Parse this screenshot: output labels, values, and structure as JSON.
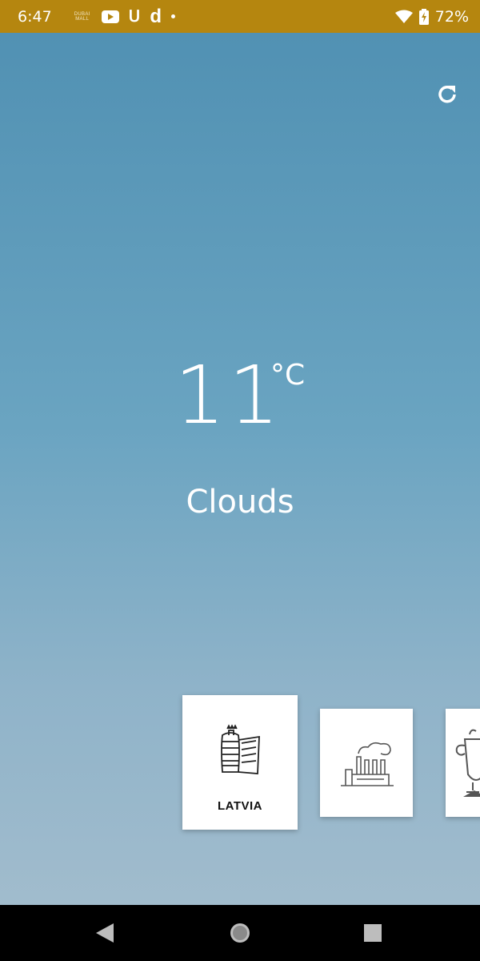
{
  "status_bar": {
    "time": "6:47",
    "mall_logo_text": "DUBAI MALL",
    "icons": [
      "mall-logo-icon",
      "youtube-icon",
      "smile-icon",
      "d-icon",
      "dot-icon",
      "wifi-icon",
      "battery-charging-icon"
    ],
    "battery": "72%",
    "background": "#b5860f"
  },
  "weather": {
    "temperature": "11",
    "unit": "°C",
    "condition": "Clouds",
    "refresh_icon": "refresh-icon",
    "gradient_top": "#5191b3",
    "gradient_bottom": "#a1bccd"
  },
  "cards": [
    {
      "label": "LATVIA",
      "icon": "building-icon"
    },
    {
      "label": "",
      "icon": "factory-icon"
    },
    {
      "label": "",
      "icon": "samovar-icon"
    }
  ],
  "nav_bar": {
    "icons": [
      "back-icon",
      "home-icon",
      "recents-icon"
    ]
  }
}
